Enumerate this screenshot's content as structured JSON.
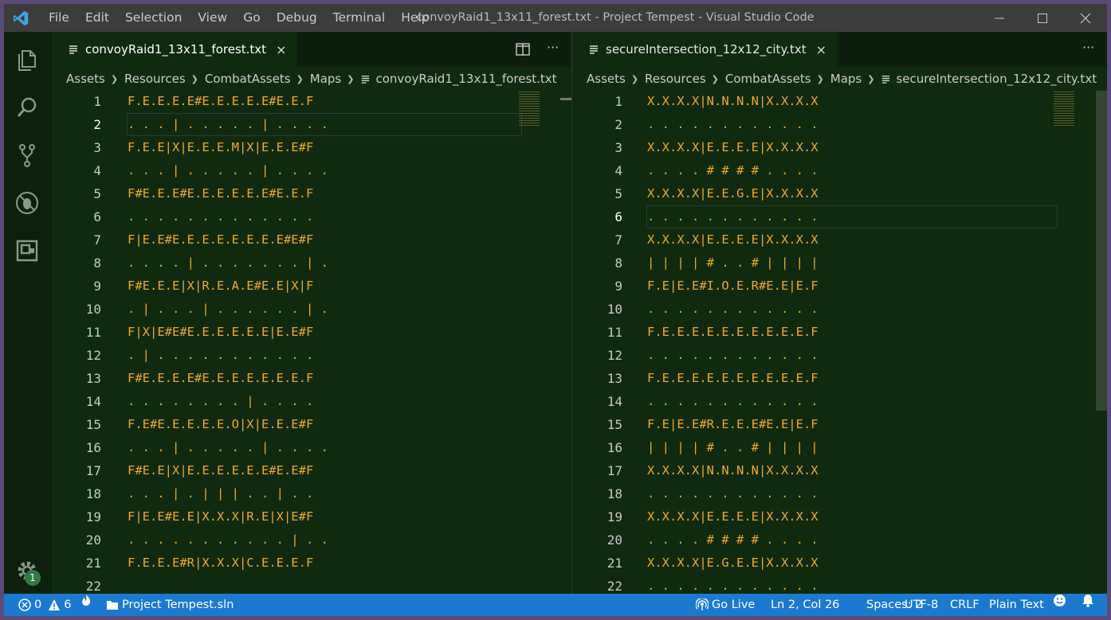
{
  "window": {
    "title": "convoyRaid1_13x11_forest.txt - Project Tempest - Visual Studio Code",
    "menu": [
      "File",
      "Edit",
      "Selection",
      "View",
      "Go",
      "Debug",
      "Terminal",
      "Help"
    ]
  },
  "activity": {
    "settings_badge": "1"
  },
  "left": {
    "tab_label": "convoyRaid1_13x11_forest.txt",
    "tab_close": "×",
    "actions_more": "···",
    "breadcrumb": [
      "Assets",
      "Resources",
      "CombatAssets",
      "Maps",
      "convoyRaid1_13x11_forest.txt"
    ],
    "lines": [
      {
        "n": "1",
        "t": "F.E.E.E.E#E.E.E.E.E#E.E.F"
      },
      {
        "n": "2",
        "t": ". . . | . . . . . | . . . ."
      },
      {
        "n": "3",
        "t": "F.E.E|X|E.E.E.M|X|E.E.E#F"
      },
      {
        "n": "4",
        "t": ". . . | . . . . . | . . . ."
      },
      {
        "n": "5",
        "t": "F#E.E.E#E.E.E.E.E.E#E.E.F"
      },
      {
        "n": "6",
        "t": ". . . . . . . . . . . . ."
      },
      {
        "n": "7",
        "t": "F|E.E#E.E.E.E.E.E.E.E#E#F"
      },
      {
        "n": "8",
        "t": ". . . . | . . . . . . . | ."
      },
      {
        "n": "9",
        "t": "F#E.E.E|X|R.E.A.E#E.E|X|F"
      },
      {
        "n": "10",
        "t": ". | . . . | . . . . . . | ."
      },
      {
        "n": "11",
        "t": "F|X|E#E#E.E.E.E.E.E|E.E#F"
      },
      {
        "n": "12",
        "t": ". | . . . . . . . . . . ."
      },
      {
        "n": "13",
        "t": "F#E.E.E.E#E.E.E.E.E.E.E.F"
      },
      {
        "n": "14",
        "t": ". . . . . . . . | . . . ."
      },
      {
        "n": "15",
        "t": "F.E#E.E.E.E.E.O|X|E.E.E#F"
      },
      {
        "n": "16",
        "t": ". . . | . . . . . | . . . ."
      },
      {
        "n": "17",
        "t": "F#E.E|X|E.E.E.E.E.E#E.E#F"
      },
      {
        "n": "18",
        "t": ". . . | . | | | . . | . ."
      },
      {
        "n": "19",
        "t": "F|E.E#E.E|X.X.X|R.E|X|E#F"
      },
      {
        "n": "20",
        "t": ". . . . . . . . . . . | . ."
      },
      {
        "n": "21",
        "t": "F.E.E.E#R|X.X.X|C.E.E.E.F"
      },
      {
        "n": "22",
        "t": ""
      }
    ]
  },
  "right": {
    "tab_label": "secureIntersection_12x12_city.txt",
    "tab_close": "×",
    "actions_more": "···",
    "breadcrumb": [
      "Assets",
      "Resources",
      "CombatAssets",
      "Maps",
      "secureIntersection_12x12_city.txt"
    ],
    "lines": [
      {
        "n": "1",
        "t": "X.X.X.X|N.N.N.N|X.X.X.X"
      },
      {
        "n": "2",
        "t": ". . . . . . . . . . . ."
      },
      {
        "n": "3",
        "t": "X.X.X.X|E.E.E.E|X.X.X.X"
      },
      {
        "n": "4",
        "t": ". . . . # # # # . . . ."
      },
      {
        "n": "5",
        "t": "X.X.X.X|E.E.G.E|X.X.X.X"
      },
      {
        "n": "6",
        "t": ". . . . . . . . . . . ."
      },
      {
        "n": "7",
        "t": "X.X.X.X|E.E.E.E|X.X.X.X"
      },
      {
        "n": "8",
        "t": "| | | | # . . # | | | |"
      },
      {
        "n": "9",
        "t": "F.E|E.E#I.O.E.R#E.E|E.F"
      },
      {
        "n": "10",
        "t": ". . . . . . . . . . . ."
      },
      {
        "n": "11",
        "t": "F.E.E.E.E.E.E.E.E.E.E.F"
      },
      {
        "n": "12",
        "t": ". . . . . . . . . . . ."
      },
      {
        "n": "13",
        "t": "F.E.E.E.E.E.E.E.E.E.E.F"
      },
      {
        "n": "14",
        "t": ". . . . . . . . . . . ."
      },
      {
        "n": "15",
        "t": "F.E|E.E#R.E.E.E#E.E|E.F"
      },
      {
        "n": "16",
        "t": "| | | | # . . # | | | |"
      },
      {
        "n": "17",
        "t": "X.X.X.X|N.N.N.N|X.X.X.X"
      },
      {
        "n": "18",
        "t": ". . . . . . . . . . . ."
      },
      {
        "n": "19",
        "t": "X.X.X.X|E.E.E.E|X.X.X.X"
      },
      {
        "n": "20",
        "t": ". . . . # # # # . . . ."
      },
      {
        "n": "21",
        "t": "X.X.X.X|E.G.E.E|X.X.X.X"
      },
      {
        "n": "22",
        "t": ". . . . . . . . . . . ."
      }
    ]
  },
  "status": {
    "errors": "0",
    "warnings": "6",
    "solution": "Project Tempest.sln",
    "go_live": "Go Live",
    "position": "Ln 2, Col 26",
    "spaces": "Spaces: 2",
    "encoding": "UTF-8",
    "eol": "CRLF",
    "language": "Plain Text"
  },
  "colors": {
    "editor_bg": "#0f2a0f",
    "text": "#f0a830",
    "statusbar": "#1b7ad0",
    "titlebar": "#3c3c3c"
  }
}
